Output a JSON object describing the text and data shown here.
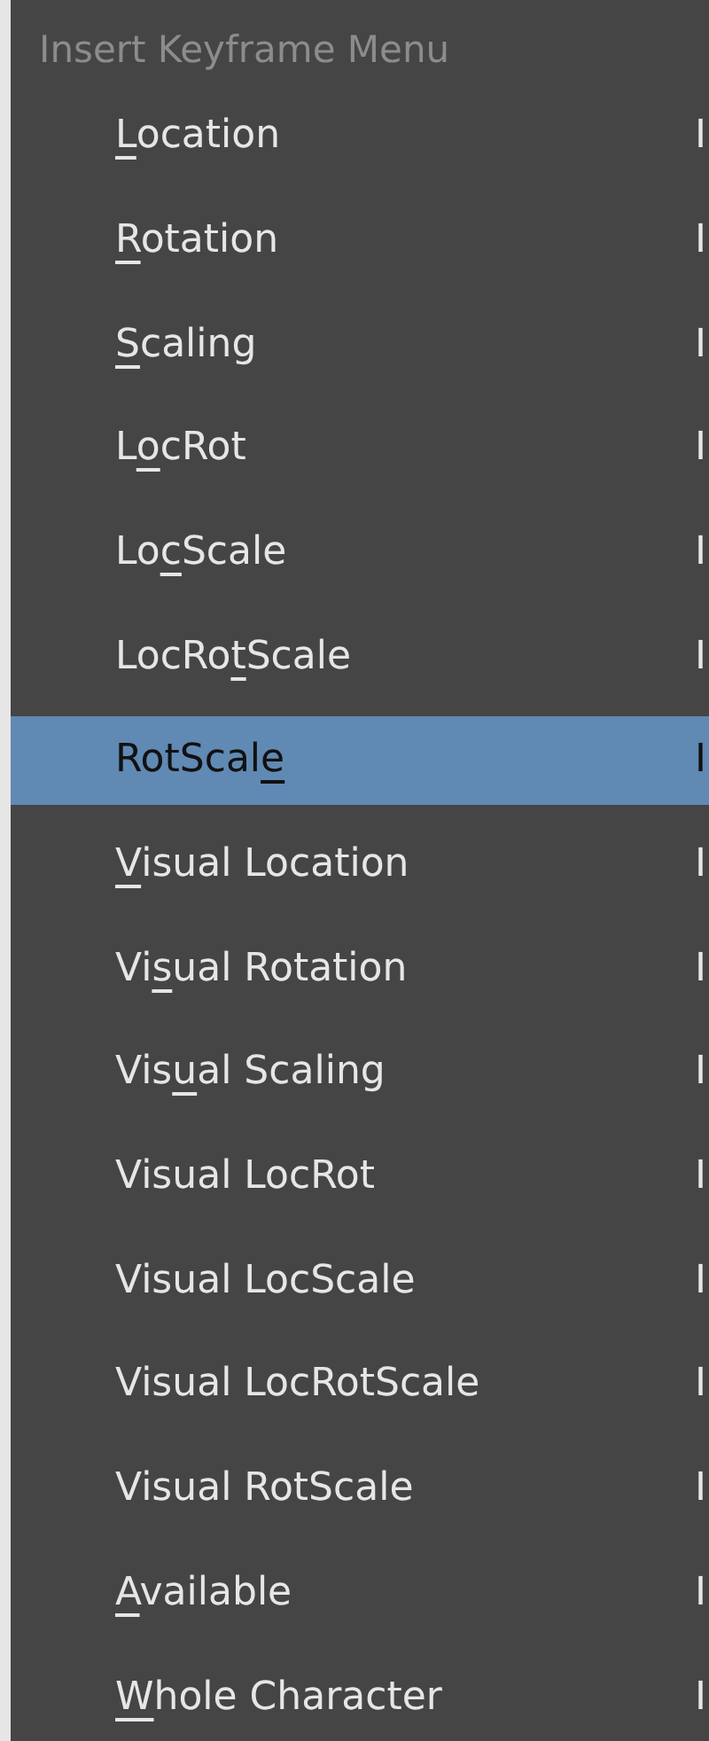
{
  "menu": {
    "title": "Insert Keyframe Menu",
    "items": [
      {
        "key": "L",
        "post": "ocation",
        "shortcut": "I",
        "selected": false
      },
      {
        "key": "R",
        "post": "otation",
        "shortcut": "I",
        "selected": false
      },
      {
        "key": "S",
        "post": "caling",
        "shortcut": "I",
        "selected": false
      },
      {
        "pre": "L",
        "key": "o",
        "post": "cRot",
        "shortcut": "I",
        "selected": false
      },
      {
        "pre": "Lo",
        "key": "c",
        "post": "Scale",
        "shortcut": "I",
        "selected": false
      },
      {
        "pre": "LocRo",
        "key": "t",
        "post": "Scale",
        "shortcut": "I",
        "selected": false
      },
      {
        "pre": "RotScal",
        "key": "e",
        "shortcut": "I",
        "selected": true
      },
      {
        "key": "V",
        "post": "isual Location",
        "shortcut": "I",
        "selected": false
      },
      {
        "pre": "Vi",
        "key": "s",
        "post": "ual Rotation",
        "shortcut": "I",
        "selected": false
      },
      {
        "pre": "Vis",
        "key": "u",
        "post": "al Scaling",
        "shortcut": "I",
        "selected": false
      },
      {
        "pre": "Visual LocRot",
        "shortcut": "I",
        "selected": false
      },
      {
        "pre": "Visual LocScale",
        "shortcut": "I",
        "selected": false
      },
      {
        "pre": "Visual LocRotScale",
        "shortcut": "I",
        "selected": false
      },
      {
        "pre": "Visual RotScale",
        "shortcut": "I",
        "selected": false
      },
      {
        "key": "A",
        "post": "vailable",
        "shortcut": "I",
        "selected": false
      },
      {
        "key": "W",
        "post": "hole Character",
        "shortcut": "I",
        "selected": false
      }
    ]
  }
}
